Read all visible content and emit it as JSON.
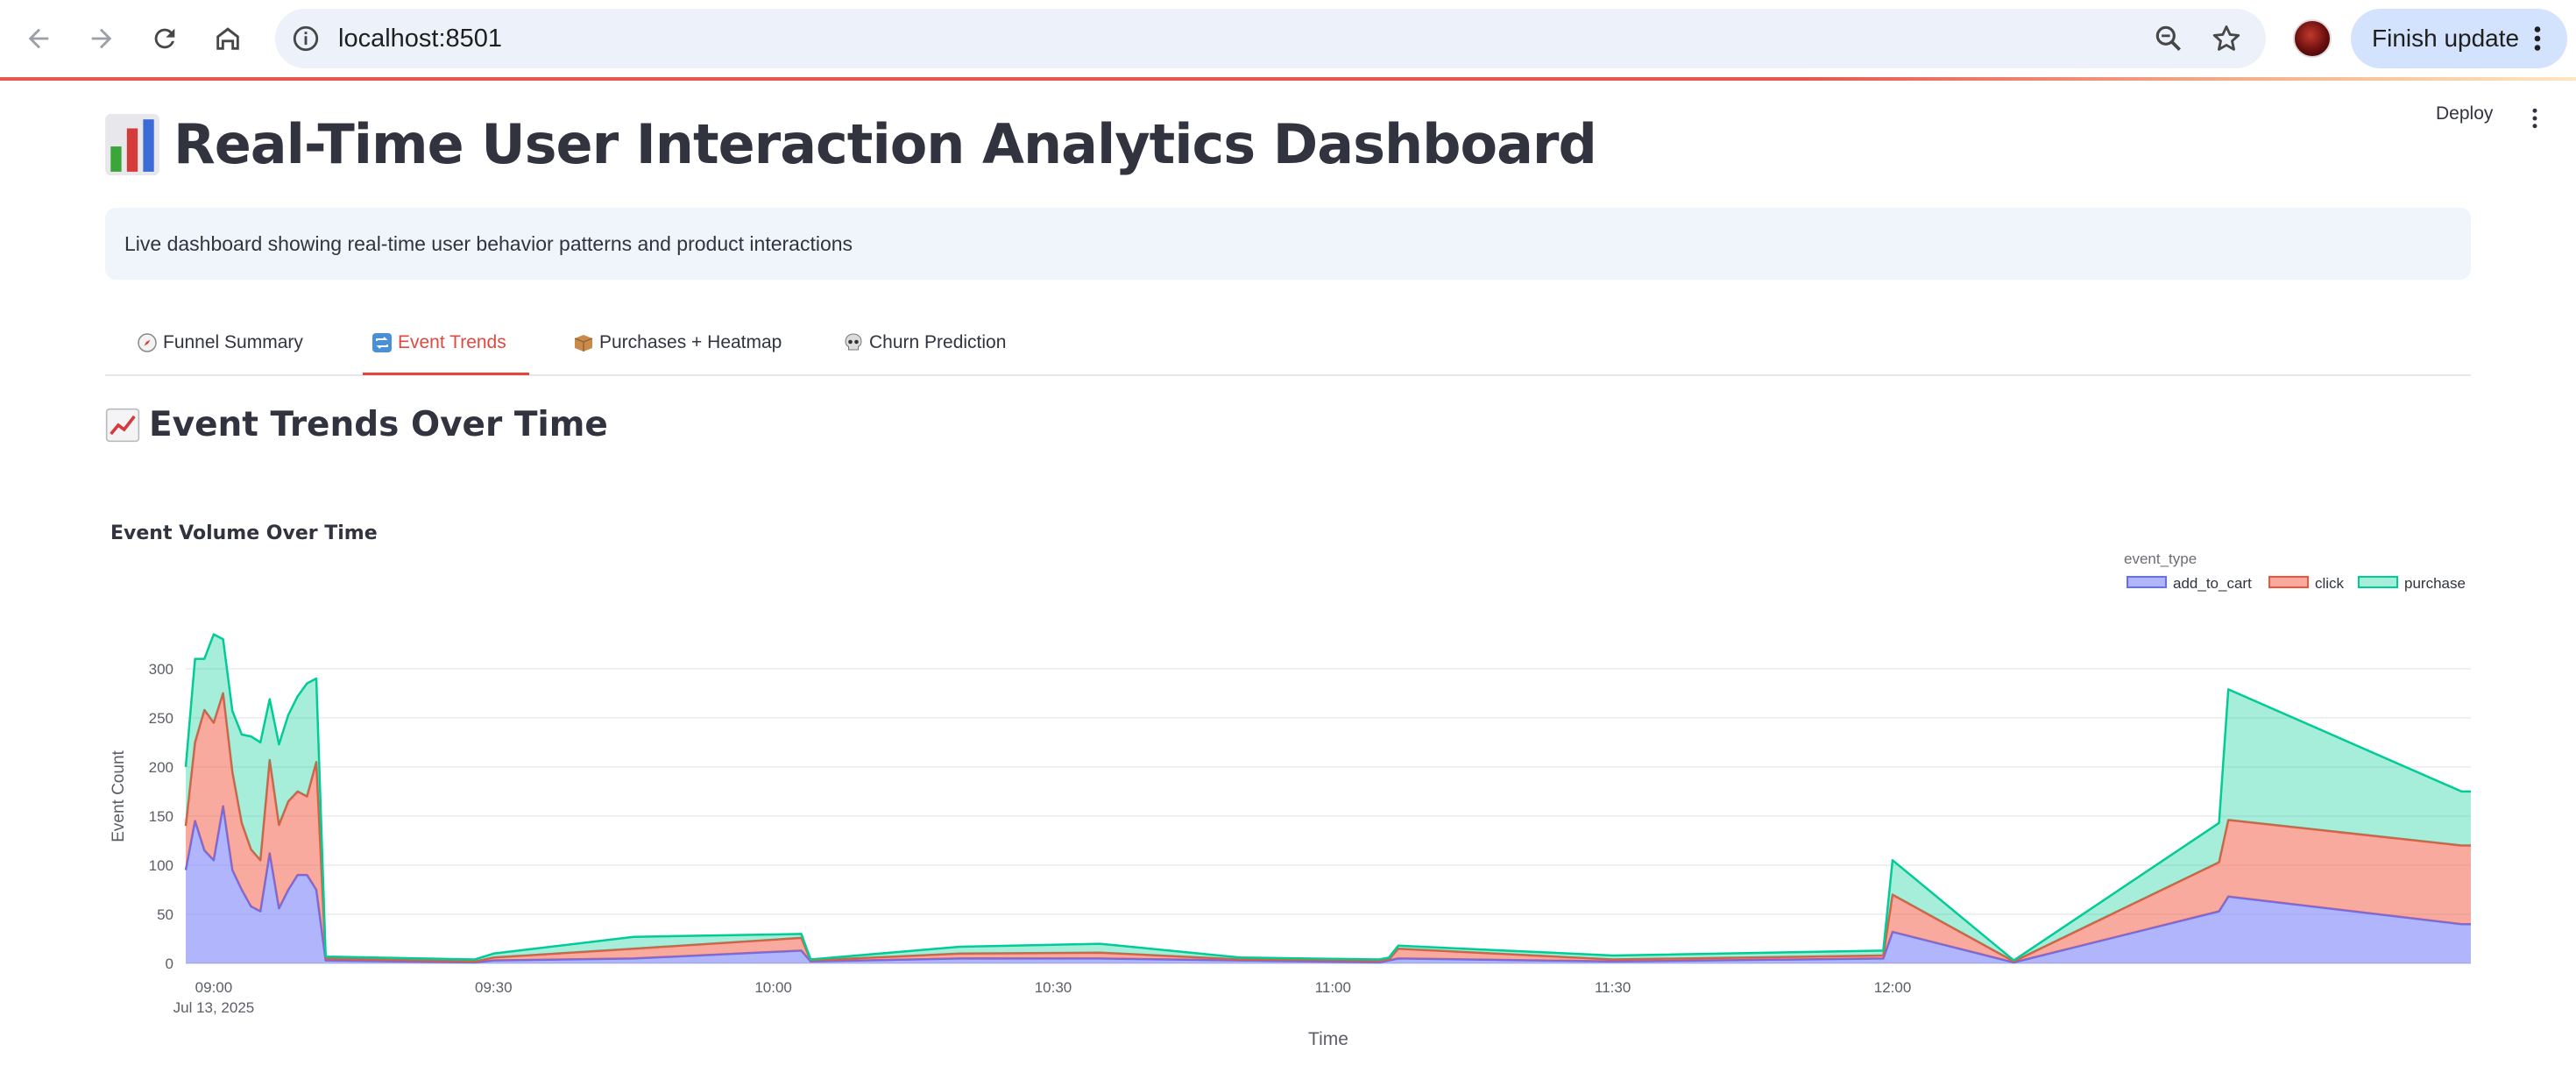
{
  "browser": {
    "url": "localhost:8501",
    "finish_update_label": "Finish update"
  },
  "app": {
    "deploy_label": "Deploy",
    "title": "Real-Time User Interaction Analytics Dashboard",
    "title_icon": "bar-chart-icon",
    "info_text": "Live dashboard showing real-time user behavior patterns and product interactions",
    "tabs": [
      {
        "label": "Funnel Summary",
        "icon": "compass-icon",
        "active": false
      },
      {
        "label": "Event Trends",
        "icon": "repeat-icon",
        "active": true
      },
      {
        "label": "Purchases + Heatmap",
        "icon": "package-icon",
        "active": false
      },
      {
        "label": "Churn Prediction",
        "icon": "skull-icon",
        "active": false
      }
    ],
    "section_title": "Event Trends Over Time",
    "section_icon": "chart-increasing-icon"
  },
  "colors": {
    "accent": "#e0483e",
    "add_to_cart": "#636efa",
    "click": "#ef553b",
    "purchase": "#00cc96"
  },
  "chart_data": {
    "type": "area",
    "title": "Event Volume Over Time",
    "xlabel": "Time",
    "ylabel": "Event Count",
    "legend_title": "event_type",
    "legend_position": "top-right",
    "grid": true,
    "ylim": [
      0,
      340
    ],
    "yticks": [
      0,
      50,
      100,
      150,
      200,
      250,
      300
    ],
    "xlim": [
      "08:57",
      "13:02"
    ],
    "xticks": [
      {
        "value": "09:00",
        "label": "09:00",
        "sublabel": "Jul 13, 2025"
      },
      {
        "value": "09:30",
        "label": "09:30"
      },
      {
        "value": "10:00",
        "label": "10:00"
      },
      {
        "value": "10:30",
        "label": "10:30"
      },
      {
        "value": "11:00",
        "label": "11:00"
      },
      {
        "value": "11:30",
        "label": "11:30"
      },
      {
        "value": "12:00",
        "label": "12:00"
      }
    ],
    "x": [
      "08:57",
      "08:58",
      "08:59",
      "09:00",
      "09:01",
      "09:02",
      "09:03",
      "09:04",
      "09:05",
      "09:06",
      "09:07",
      "09:08",
      "09:09",
      "09:10",
      "09:11",
      "09:12",
      "09:28",
      "09:30",
      "09:45",
      "10:03",
      "10:04",
      "10:20",
      "10:35",
      "10:50",
      "11:05",
      "11:06",
      "11:07",
      "11:30",
      "11:59",
      "12:00",
      "12:13",
      "12:35",
      "12:36",
      "13:01",
      "13:02"
    ],
    "series": [
      {
        "name": "add_to_cart",
        "values": [
          95,
          145,
          115,
          105,
          160,
          95,
          75,
          58,
          53,
          112,
          56,
          75,
          90,
          90,
          75,
          3,
          1,
          3,
          5,
          13,
          2,
          5,
          5,
          3,
          1,
          3,
          5,
          2,
          5,
          32,
          1,
          53,
          68,
          40,
          40
        ]
      },
      {
        "name": "click",
        "values": [
          45,
          80,
          143,
          140,
          115,
          100,
          68,
          58,
          52,
          95,
          85,
          90,
          85,
          80,
          130,
          2,
          1,
          3,
          10,
          13,
          1,
          5,
          6,
          1,
          2,
          1,
          10,
          2,
          3,
          38,
          1,
          50,
          78,
          80,
          80
        ]
      },
      {
        "name": "purchase",
        "values": [
          60,
          85,
          52,
          90,
          55,
          62,
          90,
          115,
          120,
          62,
          82,
          88,
          97,
          115,
          85,
          2,
          2,
          4,
          12,
          4,
          1,
          7,
          9,
          2,
          1,
          2,
          3,
          4,
          5,
          35,
          1,
          40,
          133,
          55,
          55
        ]
      }
    ]
  }
}
